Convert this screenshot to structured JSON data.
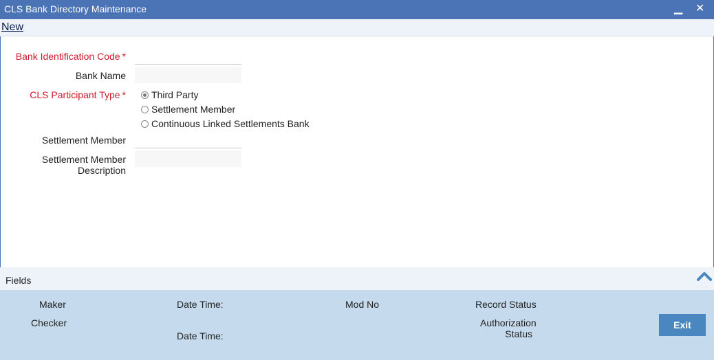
{
  "window": {
    "title": "CLS Bank Directory Maintenance",
    "minimize_glyph": "▁",
    "close_glyph": "✕"
  },
  "toolbar": {
    "new_label": "New"
  },
  "form": {
    "bank_id_code_label": "Bank Identification Code",
    "bank_id_code_value": "",
    "bank_name_label": "Bank Name",
    "bank_name_value": "",
    "participant_type_label": "CLS Participant Type",
    "required_marker": "*",
    "participant_options": [
      {
        "label": "Third Party",
        "selected": true
      },
      {
        "label": "Settlement Member",
        "selected": false
      },
      {
        "label": "Continuous Linked Settlements Bank",
        "selected": false
      }
    ],
    "settlement_member_label": "Settlement Member",
    "settlement_member_value": "",
    "settlement_member_desc_label_line1": "Settlement Member",
    "settlement_member_desc_label_line2": "Description",
    "settlement_member_desc_value": ""
  },
  "fields_bar": {
    "label": "Fields",
    "icon": "chevron-up-icon"
  },
  "audit": {
    "maker_label": "Maker",
    "checker_label": "Checker",
    "date_time_label_1": "Date Time:",
    "date_time_label_2": "Date Time:",
    "mod_no_label": "Mod No",
    "record_status_label": "Record Status",
    "authorization_status_line1": "Authorization",
    "authorization_status_line2": "Status",
    "exit_label": "Exit"
  },
  "colors": {
    "titlebar": "#4a74b5",
    "audit_bg": "#c5dbed",
    "required": "#d0182a",
    "exit_button": "#4a86bf"
  }
}
